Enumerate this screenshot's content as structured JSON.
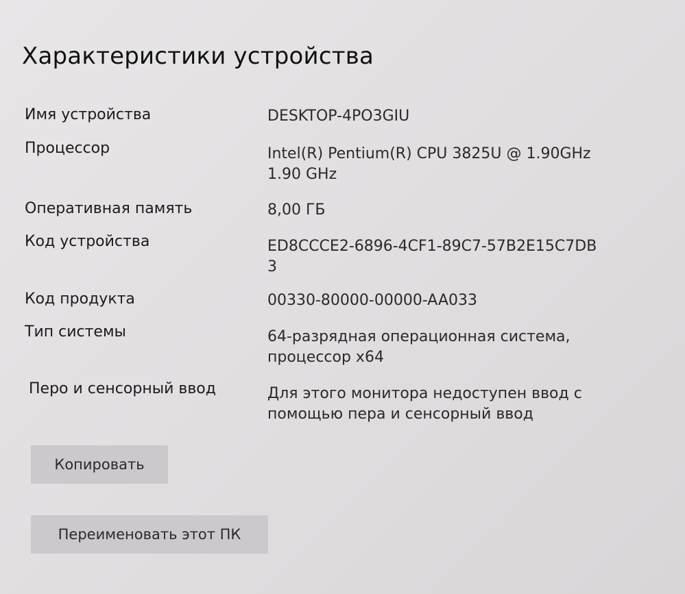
{
  "section": {
    "title": "Характеристики устройства"
  },
  "specs": [
    {
      "label": "Имя устройства",
      "lines": [
        "DESKTOP-4PO3GIU"
      ]
    },
    {
      "label": "Процессор",
      "lines": [
        "Intel(R) Pentium(R) CPU 3825U @ 1.90GHz",
        "1.90 GHz"
      ]
    },
    {
      "label": "Оперативная память",
      "lines": [
        "8,00 ГБ"
      ]
    },
    {
      "label": "Код устройства",
      "lines": [
        "ED8CCCE2-6896-4CF1-89C7-57B2E15C7DB",
        "3"
      ]
    },
    {
      "label": "Код продукта",
      "lines": [
        "00330-80000-00000-AA033"
      ]
    },
    {
      "label": "Тип системы",
      "lines": [
        "64-разрядная операционная система,",
        "процессор x64"
      ]
    },
    {
      "label": "Перо и сенсорный ввод",
      "lines": [
        "Для этого монитора недоступен ввод с",
        "помощью пера и сенсорный ввод"
      ]
    }
  ],
  "actions": {
    "copy_label": "Копировать",
    "rename_label": "Переименовать этот ПК"
  }
}
